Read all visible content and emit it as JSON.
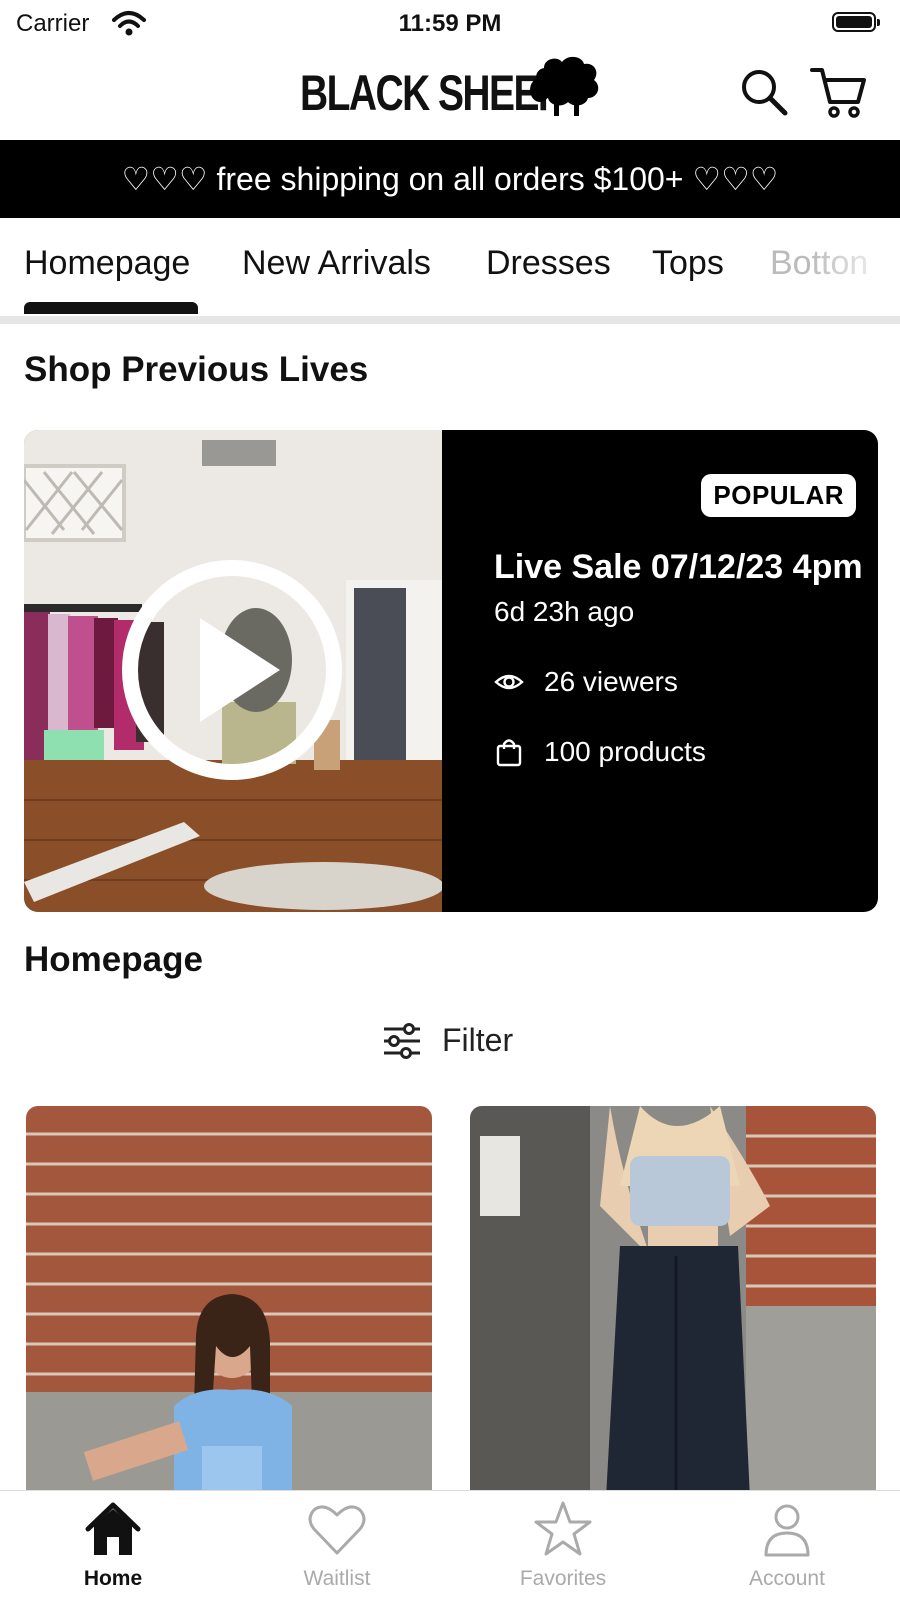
{
  "status_bar": {
    "carrier": "Carrier",
    "time": "11:59 PM"
  },
  "header": {
    "brand": "BLACK SHEEP",
    "logo_icon": "sheep-icon",
    "search_icon": "search-icon",
    "cart_icon": "cart-icon"
  },
  "promo": {
    "text": "♡♡♡ free shipping on all orders $100+ ♡♡♡"
  },
  "tabs": [
    {
      "label": "Homepage",
      "active": true
    },
    {
      "label": "New Arrivals"
    },
    {
      "label": "Dresses"
    },
    {
      "label": "Tops"
    },
    {
      "label": "Botton"
    }
  ],
  "previous_lives": {
    "title": "Shop Previous Lives",
    "card": {
      "badge": "POPULAR",
      "title": "Live Sale 07/12/23 4pm",
      "ago": "6d 23h ago",
      "viewers": "26 viewers",
      "products": "100 products",
      "play_icon": "play-icon"
    }
  },
  "homepage_section": {
    "title": "Homepage",
    "filter_label": "Filter",
    "filter_icon": "sliders-icon"
  },
  "bottom_nav": [
    {
      "label": "Home",
      "icon": "home-icon",
      "active": true
    },
    {
      "label": "Waitlist",
      "icon": "heart-icon"
    },
    {
      "label": "Favorites",
      "icon": "star-icon"
    },
    {
      "label": "Account",
      "icon": "person-icon"
    }
  ],
  "colors": {
    "primary": "#000000",
    "background": "#ffffff",
    "inactive": "#aaaaaa",
    "promo_bg": "#000000"
  }
}
